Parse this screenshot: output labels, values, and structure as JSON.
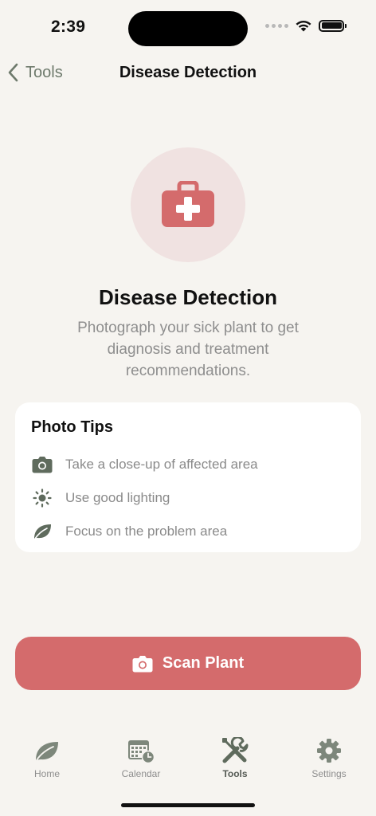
{
  "status_bar": {
    "time": "2:39"
  },
  "nav": {
    "back_label": "Tools",
    "title": "Disease Detection"
  },
  "hero": {
    "icon": "medkit-icon",
    "title": "Disease Detection",
    "description": "Photograph your sick plant to get diagnosis and treatment recommendations."
  },
  "tips": {
    "title": "Photo Tips",
    "items": [
      {
        "icon": "camera-icon",
        "text": "Take a close-up of affected area"
      },
      {
        "icon": "sun-icon",
        "text": "Use good lighting"
      },
      {
        "icon": "leaf-icon",
        "text": "Focus on the problem area"
      }
    ]
  },
  "scan_button": {
    "label": "Scan Plant",
    "icon": "camera-icon"
  },
  "tab_bar": {
    "active": "Tools",
    "items": [
      {
        "label": "Home",
        "icon": "leaf-icon"
      },
      {
        "label": "Calendar",
        "icon": "calendar-icon"
      },
      {
        "label": "Tools",
        "icon": "tools-icon"
      },
      {
        "label": "Settings",
        "icon": "gear-icon"
      }
    ]
  },
  "colors": {
    "background": "#f6f4f0",
    "accent": "#d46b6c",
    "hero_circle": "#f0e2e1",
    "icon_green": "#5f6b5d",
    "tab_icon": "#7d877b"
  }
}
